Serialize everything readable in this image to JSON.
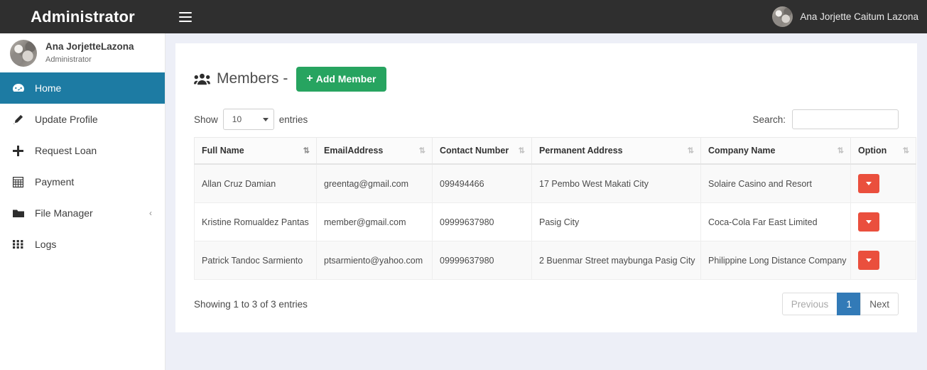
{
  "topbar": {
    "brand_title": "Administrator",
    "menu_toggle_icon": "hamburger-icon",
    "user_name": "Ana Jorjette Caitum Lazona",
    "user_avatar_icon": "avatar"
  },
  "sidebar": {
    "profile": {
      "name": "Ana JorjetteLazona",
      "role": "Administrator",
      "avatar_icon": "avatar"
    },
    "items": [
      {
        "label": "Home",
        "icon": "dashboard-icon",
        "active": true,
        "caret": ""
      },
      {
        "label": "Update Profile",
        "icon": "pencil-icon",
        "active": false,
        "caret": ""
      },
      {
        "label": "Request Loan",
        "icon": "plus-icon",
        "active": false,
        "caret": ""
      },
      {
        "label": "Payment",
        "icon": "calculator-icon",
        "active": false,
        "caret": ""
      },
      {
        "label": "File Manager",
        "icon": "folder-icon",
        "active": false,
        "caret": "‹"
      },
      {
        "label": "Logs",
        "icon": "grid-icon",
        "active": false,
        "caret": ""
      }
    ]
  },
  "main": {
    "page_title": "Members -",
    "page_title_icon": "people-icon",
    "add_member_label": "Add Member",
    "add_member_plus": "+",
    "controls": {
      "show_label": "Show",
      "entries_label": "entries",
      "entries_value": "10",
      "search_label": "Search:",
      "search_value": "",
      "search_placeholder": ""
    },
    "table": {
      "columns": [
        {
          "label": "Full Name",
          "sort": "asc"
        },
        {
          "label": "EmailAddress",
          "sort": "none"
        },
        {
          "label": "Contact Number",
          "sort": "none"
        },
        {
          "label": "Permanent Address",
          "sort": "none"
        },
        {
          "label": "Company Name",
          "sort": "none"
        },
        {
          "label": "Option",
          "sort": "none"
        }
      ],
      "rows": [
        {
          "full_name": "Allan Cruz Damian",
          "email": "greentag@gmail.com",
          "contact": "099494466",
          "address": "17 Pembo West Makati City",
          "company": "Solaire Casino and Resort",
          "option_icon": "caret-down-icon"
        },
        {
          "full_name": "Kristine Romualdez Pantas",
          "email": "member@gmail.com",
          "contact": "09999637980",
          "address": "Pasig City",
          "company": "Coca-Cola Far East Limited",
          "option_icon": "caret-down-icon"
        },
        {
          "full_name": "Patrick Tandoc Sarmiento",
          "email": "ptsarmiento@yahoo.com",
          "contact": "09999637980",
          "address": "2 Buenmar Street maybunga Pasig City",
          "company": "Philippine Long Distance Company",
          "option_icon": "caret-down-icon"
        }
      ]
    },
    "footer": {
      "entries_info": "Showing 1 to 3 of 3 entries",
      "pagination": {
        "previous_label": "Previous",
        "current_page": "1",
        "next_label": "Next"
      }
    }
  },
  "colors": {
    "topbar_bg": "#2f2f2f",
    "sidebar_active": "#1d7ba3",
    "add_member_green": "#27a460",
    "option_red": "#ea4f3d",
    "page_current_blue": "#327ab7",
    "content_bg": "#edeff7"
  }
}
